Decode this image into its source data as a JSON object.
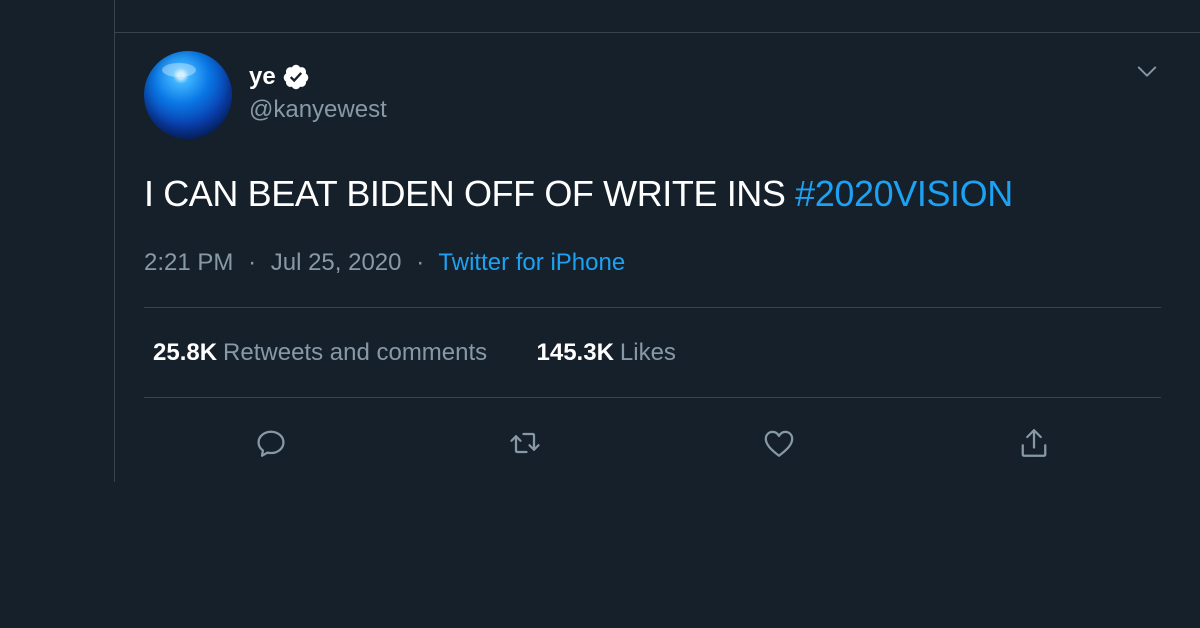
{
  "tweet": {
    "display_name": "ye",
    "handle": "@kanyewest",
    "text_main": "I CAN BEAT BIDEN OFF OF WRITE INS",
    "hashtag": "#2020VISION",
    "time": "2:21 PM",
    "date": "Jul 25, 2020",
    "separator": "·",
    "source": "Twitter for iPhone"
  },
  "stats": {
    "retweets_count": "25.8K",
    "retweets_label": "Retweets and comments",
    "likes_count": "145.3K",
    "likes_label": "Likes"
  },
  "icons": {
    "verified": "verified-badge-icon",
    "more": "chevron-down-icon",
    "reply": "reply-icon",
    "retweet": "retweet-icon",
    "like": "heart-icon",
    "share": "share-icon"
  },
  "colors": {
    "background": "#15202b",
    "border": "#38444d",
    "text_primary": "#ffffff",
    "text_secondary": "#8899a6",
    "accent": "#1da1f2"
  }
}
